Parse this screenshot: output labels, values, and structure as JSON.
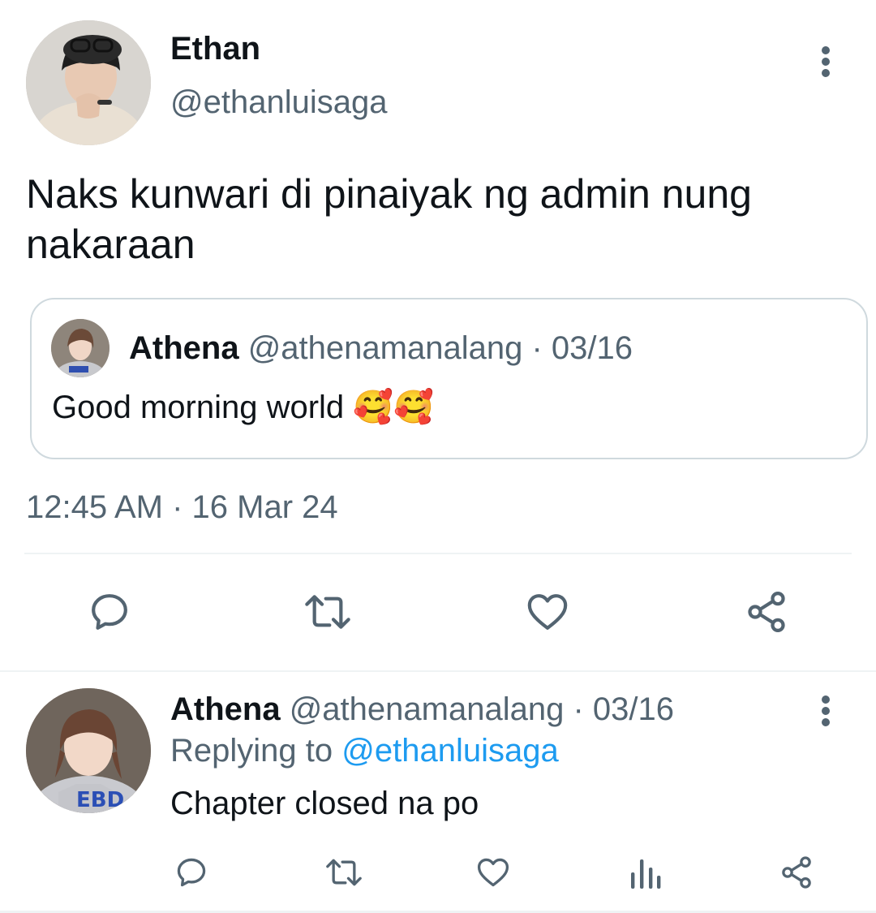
{
  "tweet": {
    "author_name": "Ethan",
    "author_handle": "@ethanluisaga",
    "text": "Naks kunwari di pinaiyak ng admin nung nakaraan",
    "timestamp": "12:45 AM · 16 Mar 24",
    "quoted": {
      "author_name": "Athena",
      "author_handle": "@athenamanalang",
      "date": "· 03/16",
      "text": "Good morning world 🥰🥰"
    },
    "actions": [
      "reply-icon",
      "retweet-icon",
      "like-icon",
      "share-icon"
    ]
  },
  "reply": {
    "author_name": "Athena",
    "author_handle": "@athenamanalang",
    "date": "· 03/16",
    "replying_prefix": "Replying to",
    "replying_to": "@ethanluisaga",
    "text": "Chapter closed na po",
    "actions": [
      "reply-icon",
      "retweet-icon",
      "like-icon",
      "analytics-icon",
      "share-icon"
    ]
  },
  "colors": {
    "text": "#0f1419",
    "muted": "#536471",
    "link": "#1d9bf0",
    "border": "#cfd9de",
    "divider": "#eff3f4"
  }
}
